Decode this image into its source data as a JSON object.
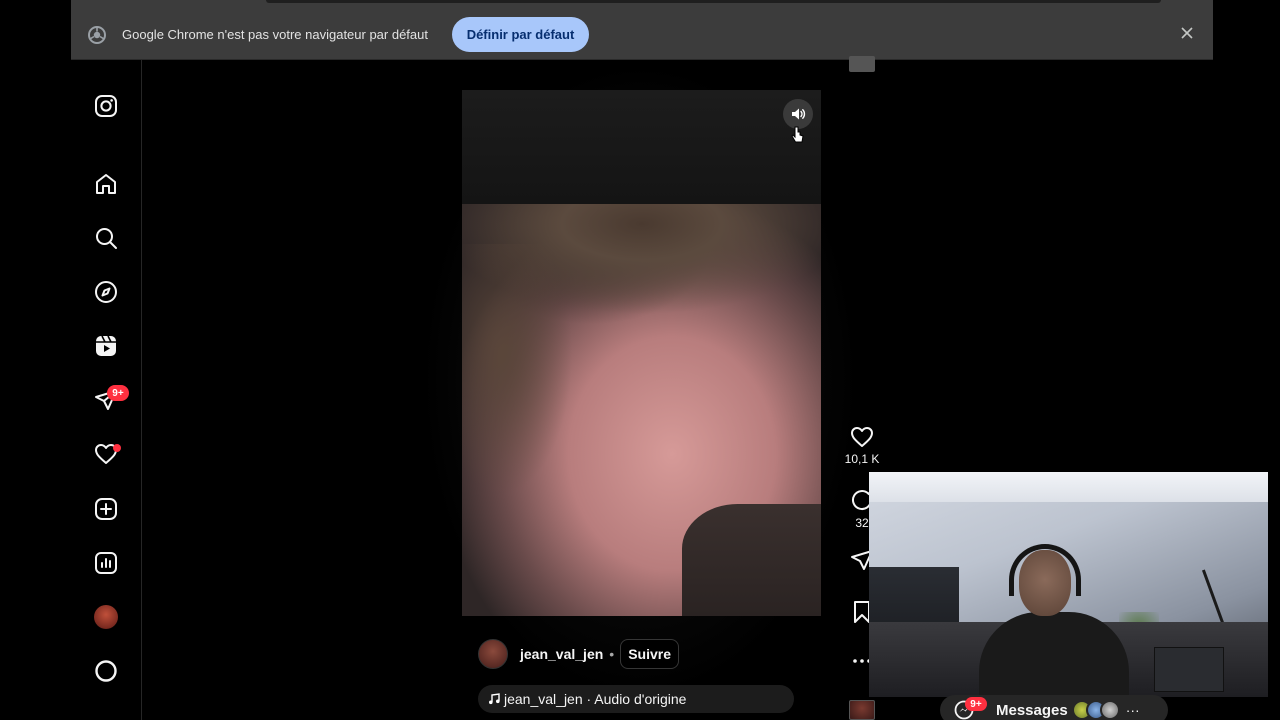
{
  "infobar": {
    "message": "Google Chrome n'est pas votre navigateur par défaut",
    "set_default_label": "Définir par défaut",
    "icon": "chrome-icon",
    "close_icon": "close-icon"
  },
  "sidebar": {
    "items": [
      {
        "name": "instagram-logo",
        "icon": "instagram-icon"
      },
      {
        "name": "home",
        "icon": "home-icon"
      },
      {
        "name": "search",
        "icon": "search-icon"
      },
      {
        "name": "explore",
        "icon": "compass-icon"
      },
      {
        "name": "reels",
        "icon": "reels-icon"
      },
      {
        "name": "messages",
        "icon": "send-icon",
        "badge": "9+"
      },
      {
        "name": "notifications",
        "icon": "heart-icon",
        "dot": true
      },
      {
        "name": "create",
        "icon": "plus-square-icon"
      },
      {
        "name": "dashboard",
        "icon": "chart-icon"
      },
      {
        "name": "profile",
        "icon": "avatar-icon"
      },
      {
        "name": "threads",
        "icon": "circle-icon"
      }
    ],
    "badge": "9+"
  },
  "reel": {
    "author": "jean_val_jen",
    "separator": "•",
    "follow_label": "Suivre",
    "audio_text": "jean_val_jen · Audio d'origine",
    "sound_icon": "volume-icon"
  },
  "actions": {
    "likes": "10,1 K",
    "comments": "32"
  },
  "messages_bar": {
    "label": "Messages",
    "badge": "9+",
    "more": "···"
  },
  "colors": {
    "background": "#000000",
    "infobar": "#3c3c3c",
    "button": "#a8c7fa",
    "badge": "#ff3040"
  }
}
